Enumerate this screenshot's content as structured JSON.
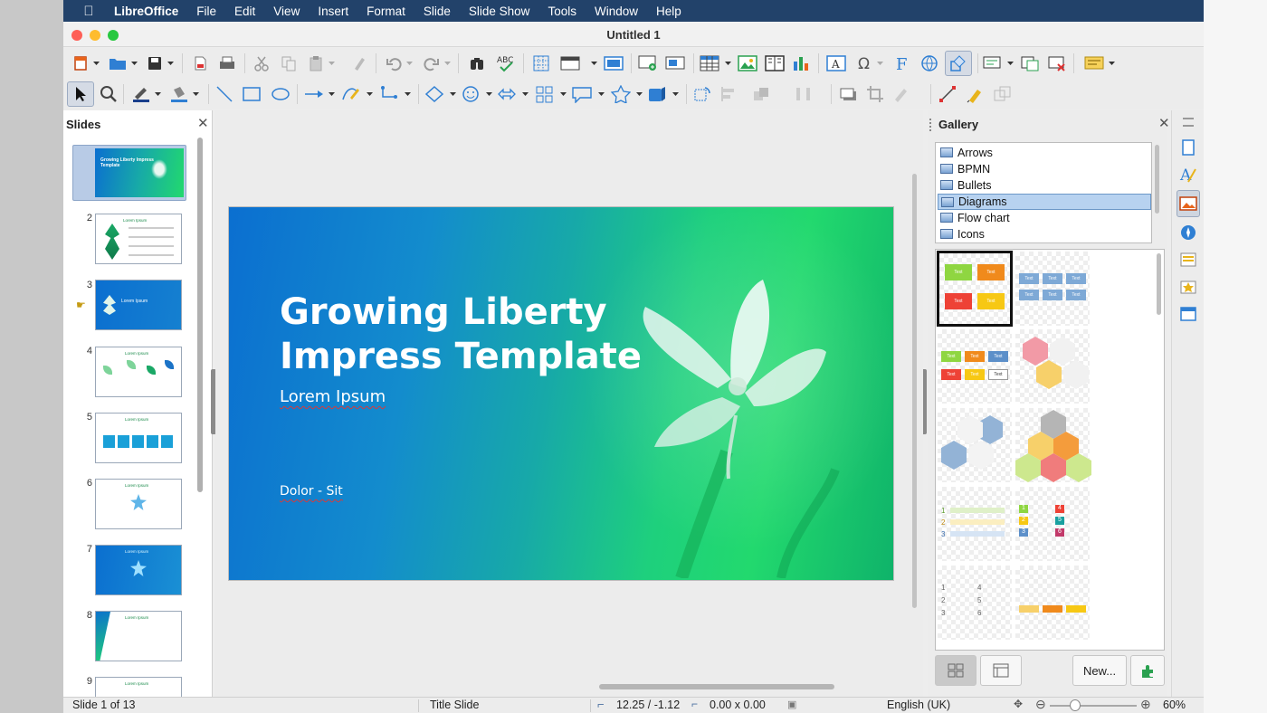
{
  "menubar": {
    "apple_icon": "apple-icon",
    "app_name": "LibreOffice",
    "items": [
      "File",
      "Edit",
      "View",
      "Insert",
      "Format",
      "Slide",
      "Slide Show",
      "Tools",
      "Window",
      "Help"
    ]
  },
  "window": {
    "title": "Untitled 1"
  },
  "slides_pane": {
    "title": "Slides",
    "slides": [
      {
        "number": "1",
        "title": "Growing Liberty Impress Template"
      },
      {
        "number": "2",
        "title": "Lorem Ipsum"
      },
      {
        "number": "3",
        "title": "Lorem Ipsum"
      },
      {
        "number": "4",
        "title": "Lorem Ipsum"
      },
      {
        "number": "5",
        "title": "Lorem Ipsum"
      },
      {
        "number": "6",
        "title": "Lorem Ipsum"
      },
      {
        "number": "7",
        "title": "Lorem Ipsum"
      },
      {
        "number": "8",
        "title": "Lorem Ipsum"
      },
      {
        "number": "9",
        "title": "Lorem Ipsum"
      }
    ]
  },
  "slide": {
    "title": "Growing Liberty Impress Template",
    "subtitle": "Lorem Ipsum",
    "footer": "Dolor - Sit"
  },
  "gallery": {
    "title": "Gallery",
    "themes": [
      "Arrows",
      "BPMN",
      "Bullets",
      "Diagrams",
      "Flow chart",
      "Icons"
    ],
    "selected_theme": "Diagrams",
    "new_button": "New...",
    "thumb_text": "Text",
    "numbers_a": [
      "1",
      "2",
      "3"
    ],
    "numbers_b": [
      "4",
      "5",
      "6"
    ]
  },
  "status": {
    "slide_position": "Slide 1 of 13",
    "layout": "Title Slide",
    "position": "12.25 / -1.12",
    "size": "0.00 x 0.00",
    "language": "English (UK)",
    "zoom": "60%"
  },
  "colors": {
    "menubar_bg": "#22426a",
    "slide_blue": "#0b6fd0",
    "slide_green": "#22d96e",
    "selection": "#b7d2f0"
  }
}
